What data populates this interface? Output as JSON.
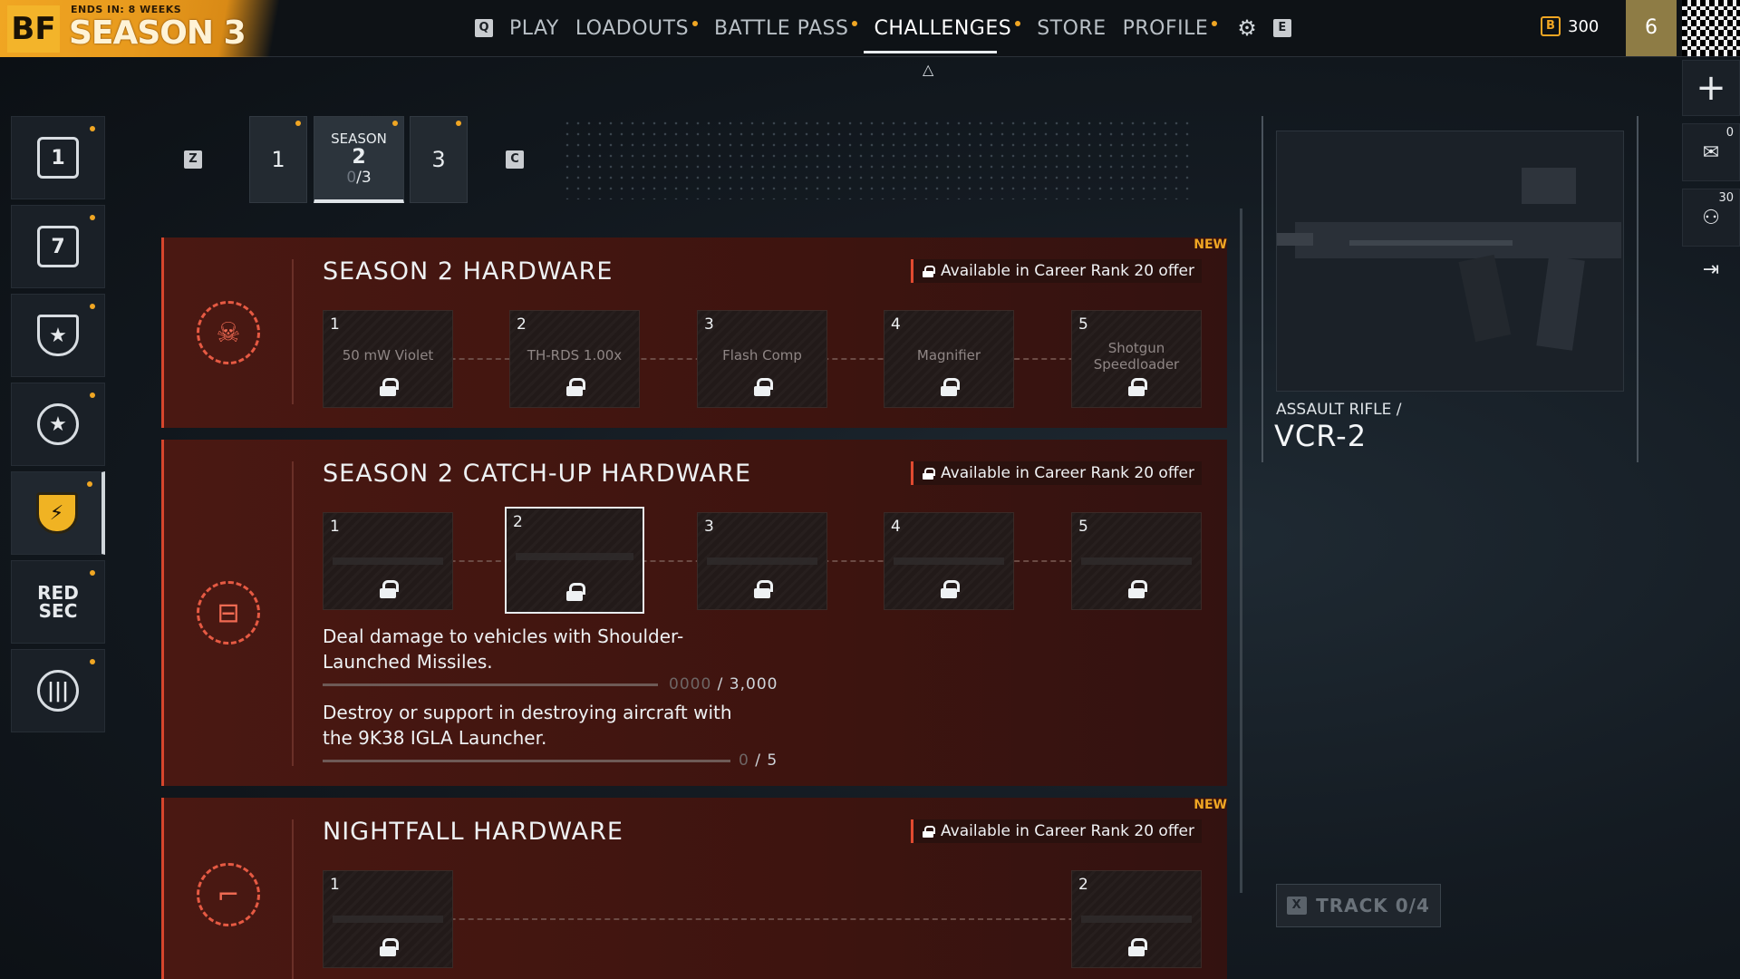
{
  "top": {
    "brand_logo": "BF",
    "ends_in": "ENDS IN: 8 WEEKS",
    "season_label": "SEASON 3",
    "play_key": "Q",
    "nav": [
      {
        "label": "PLAY",
        "dot": false
      },
      {
        "label": "LOADOUTS",
        "dot": true
      },
      {
        "label": "BATTLE PASS",
        "dot": true
      },
      {
        "label": "CHALLENGES",
        "dot": true,
        "active": true
      },
      {
        "label": "STORE",
        "dot": false
      },
      {
        "label": "PROFILE",
        "dot": true
      }
    ],
    "settings_icon": "gear-icon",
    "e_key": "E",
    "currency_symbol": "B",
    "currency_amount": "300",
    "rank": "6"
  },
  "left_rail": [
    {
      "name": "daily",
      "glyph": "1",
      "icon": "calendar-day-icon"
    },
    {
      "name": "weekly",
      "glyph": "7",
      "icon": "calendar-week-icon"
    },
    {
      "name": "career",
      "glyph": "★",
      "icon": "badge-star-icon"
    },
    {
      "name": "mastery",
      "glyph": "★",
      "icon": "circle-star-icon"
    },
    {
      "name": "seasonal",
      "glyph": "⚡",
      "icon": "seasonal-shield-icon",
      "active": true
    },
    {
      "name": "redsec",
      "glyph": "RED SEC",
      "icon": "redsec-icon"
    },
    {
      "name": "faction",
      "glyph": "|||",
      "icon": "eagle-icon"
    }
  ],
  "season_tabs": {
    "prev_key": "Z",
    "next_key": "C",
    "tabs": [
      {
        "label": "1"
      },
      {
        "heading": "SEASON",
        "label": "2",
        "progress_dim": "0",
        "progress": "/3",
        "active": true
      },
      {
        "label": "3"
      }
    ]
  },
  "panels": [
    {
      "title": "SEASON 2 HARDWARE",
      "offer": "Available in Career Rank 20 offer",
      "new": "NEW",
      "emblem": "skull-crossbones-icon",
      "items": [
        {
          "num": "1",
          "label": "50 mW Violet"
        },
        {
          "num": "2",
          "label": "TH-RDS 1.00x"
        },
        {
          "num": "3",
          "label": "Flash Comp"
        },
        {
          "num": "4",
          "label": "Magnifier"
        },
        {
          "num": "5",
          "label": "Shotgun Speedloader"
        }
      ]
    },
    {
      "title": "SEASON 2 CATCH-UP HARDWARE",
      "offer": "Available in Career Rank 20 offer",
      "emblem": "grenade-icon",
      "items": [
        {
          "num": "1"
        },
        {
          "num": "2",
          "selected": true
        },
        {
          "num": "3"
        },
        {
          "num": "4"
        },
        {
          "num": "5"
        }
      ],
      "challenges": [
        {
          "desc": "Deal damage to vehicles with Shoulder-Launched Missiles.",
          "current_dim": "0000",
          "target": "/ 3,000",
          "progress": 0
        },
        {
          "desc": "Destroy or support in destroying aircraft with the 9K38 IGLA Launcher.",
          "current_dim": "0",
          "target": "/ 5",
          "progress": 0
        }
      ]
    },
    {
      "title": "NIGHTFALL HARDWARE",
      "offer": "Available in Career Rank 20 offer",
      "new": "NEW",
      "emblem": "pistol-icon",
      "items": [
        {
          "num": "1"
        },
        {
          "num": "2"
        }
      ]
    }
  ],
  "weapon": {
    "category": "ASSAULT RIFLE /",
    "name": "VCR-2"
  },
  "track": {
    "key": "X",
    "label": "TRACK 0/4"
  },
  "right_rail": [
    {
      "icon": "plus-icon",
      "count": ""
    },
    {
      "icon": "mail-icon",
      "count": "0"
    },
    {
      "icon": "squad-icon",
      "count": "30"
    },
    {
      "icon": "exit-icon",
      "count": ""
    }
  ]
}
